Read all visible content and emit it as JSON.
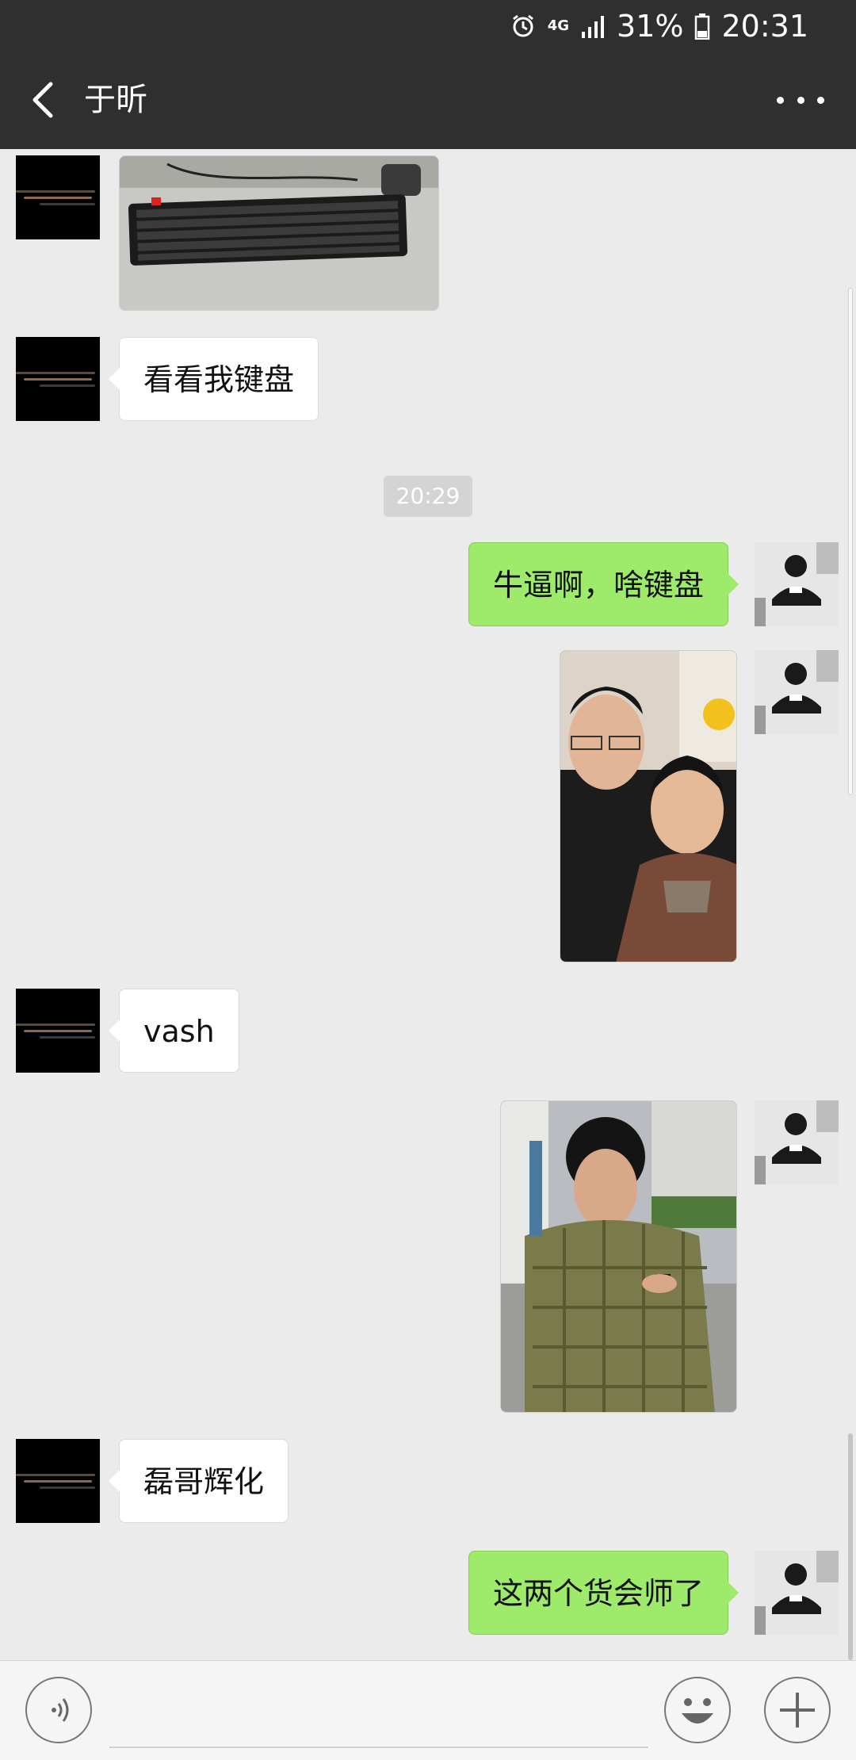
{
  "status_bar": {
    "network": "4G",
    "battery": "31%",
    "time": "20:31"
  },
  "nav": {
    "title": "于昕",
    "back_icon": "chevron-left-icon",
    "more_icon": "more-dots-icon"
  },
  "chat": {
    "timestamp": "20:29",
    "messages": [
      {
        "from": "contact",
        "type": "image",
        "content": "keyboard-photo"
      },
      {
        "from": "contact",
        "type": "text",
        "text": "看看我键盘"
      },
      {
        "from": "me",
        "type": "text",
        "text": "牛逼啊，啥键盘"
      },
      {
        "from": "me",
        "type": "image",
        "content": "two-people-selfie"
      },
      {
        "from": "contact",
        "type": "text",
        "text": "vash"
      },
      {
        "from": "me",
        "type": "image",
        "content": "man-checking-phone"
      },
      {
        "from": "contact",
        "type": "text",
        "text": "磊哥辉化"
      },
      {
        "from": "me",
        "type": "text",
        "text": "这两个货会师了"
      }
    ]
  },
  "input_bar": {
    "voice_icon": "voice-icon",
    "emoji_icon": "emoji-icon",
    "plus_icon": "plus-icon"
  },
  "colors": {
    "header": "#2f2f2f",
    "chat_bg": "#ebebeb",
    "outgoing_bubble": "#9eea6a",
    "incoming_bubble": "#ffffff"
  }
}
